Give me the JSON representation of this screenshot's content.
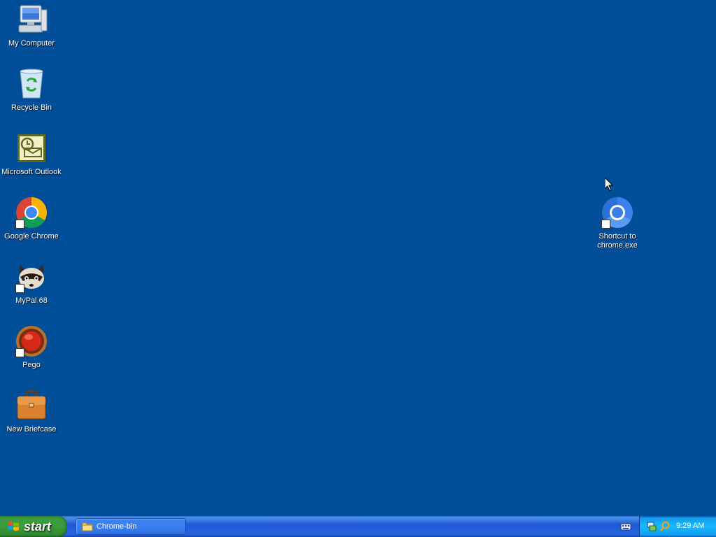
{
  "desktop": {
    "background_color": "#004E98",
    "icons": [
      {
        "name": "my-computer",
        "label": "My Computer",
        "icon": "computer-icon"
      },
      {
        "name": "recycle-bin",
        "label": "Recycle Bin",
        "icon": "recycle-bin-icon"
      },
      {
        "name": "microsoft-outlook",
        "label": "Microsoft Outlook",
        "icon": "outlook-icon"
      },
      {
        "name": "google-chrome",
        "label": "Google Chrome",
        "icon": "chrome-icon",
        "shortcut": true
      },
      {
        "name": "mypal-68",
        "label": "MyPal 68",
        "icon": "mypal-raccoon-icon",
        "shortcut": true
      },
      {
        "name": "pego",
        "label": "Pego",
        "icon": "pego-red-orb-icon",
        "shortcut": true
      },
      {
        "name": "new-briefcase",
        "label": "New Briefcase",
        "icon": "briefcase-icon"
      },
      {
        "name": "shortcut-chrome-exe",
        "label": "Shortcut to\nchrome.exe",
        "icon": "chrome-blue-icon",
        "shortcut": true
      }
    ]
  },
  "taskbar": {
    "start_label": "start",
    "tasks": [
      {
        "label": "Chrome-bin",
        "icon": "folder-icon"
      }
    ],
    "tray": {
      "clock": "9:29 AM",
      "icons": [
        "network-icon",
        "search-icon"
      ]
    },
    "colors": {
      "taskbar_blue": "#245EDC",
      "start_green": "#3A9C3C",
      "tray_blue": "#0F9BF0"
    }
  }
}
